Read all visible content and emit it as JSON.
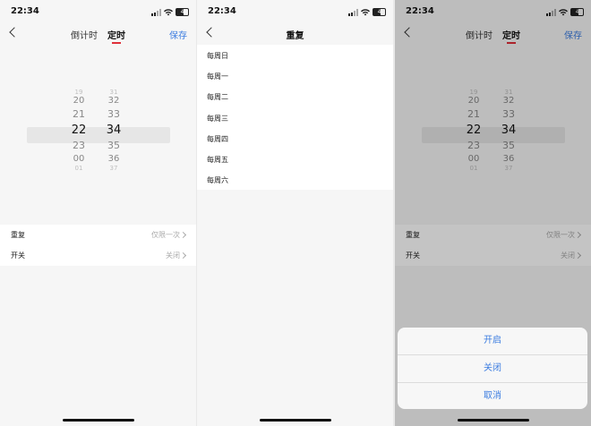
{
  "status": {
    "time": "22:34",
    "battery": "4"
  },
  "timer_screen": {
    "tabs": [
      "倒计时",
      "定时"
    ],
    "save_label": "保存",
    "hours": [
      "19",
      "20",
      "21",
      "22",
      "23",
      "00",
      "01"
    ],
    "minutes": [
      "31",
      "32",
      "33",
      "34",
      "35",
      "36",
      "37"
    ],
    "settings": [
      {
        "label": "重复",
        "value": "仅限一次"
      },
      {
        "label": "开关",
        "value": "关闭"
      }
    ]
  },
  "repeat_screen": {
    "title": "重复",
    "days": [
      "每周日",
      "每周一",
      "每周二",
      "每周三",
      "每周四",
      "每周五",
      "每周六"
    ]
  },
  "action_sheet": {
    "options": [
      "开启",
      "关闭",
      "取消"
    ]
  },
  "colors": {
    "accent": "#3b7ce0",
    "tab_indicator": "#e0303a"
  }
}
